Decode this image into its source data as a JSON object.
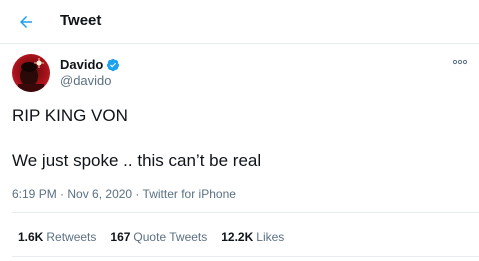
{
  "header": {
    "title": "Tweet"
  },
  "author": {
    "display_name": "Davido",
    "handle": "@davido",
    "verified": true
  },
  "tweet": {
    "line1": "RIP KING VON",
    "line2": "We just spoke .. this can’t be real"
  },
  "meta": {
    "time": "6:19 PM",
    "sep1": " · ",
    "date": "Nov 6, 2020",
    "sep2": " · ",
    "source": "Twitter for iPhone"
  },
  "stats": {
    "retweets_count": "1.6K",
    "retweets_label": "Retweets",
    "quotes_count": "167",
    "quotes_label": "Quote Tweets",
    "likes_count": "12.2K",
    "likes_label": "Likes"
  },
  "icons": {
    "back": "arrow-left-icon",
    "more": "more-horizontal-icon",
    "verified": "verified-badge-icon"
  },
  "colors": {
    "accent": "#1da1f2",
    "secondary_text": "#5b7083",
    "primary_text": "#0f1419",
    "divider": "#e6ecf0"
  }
}
